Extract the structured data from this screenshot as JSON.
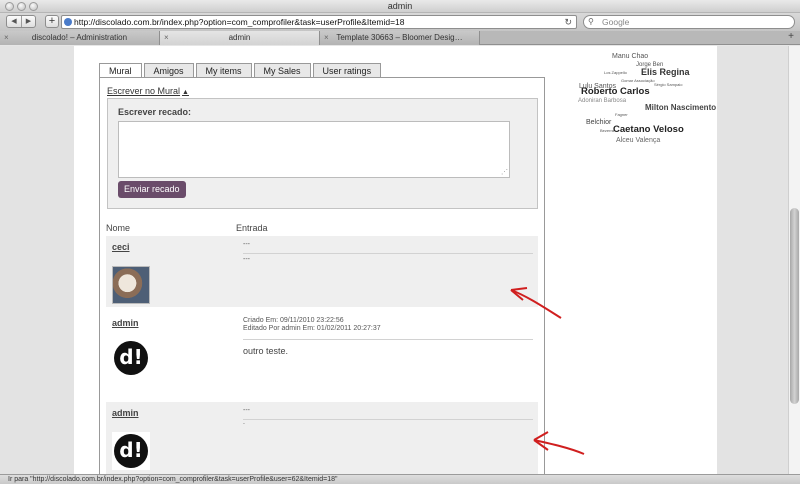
{
  "window": {
    "title": "admin"
  },
  "toolbar": {
    "back": "◀",
    "forward": "▶",
    "new_tab": "+",
    "url": "http://discolado.com.br/index.php?option=com_comprofiler&task=userProfile&Itemid=18",
    "reload": "↻",
    "search_placeholder": "Google"
  },
  "tabs": [
    {
      "label": "discolado! – Administration"
    },
    {
      "label": "admin"
    },
    {
      "label": "Template 30663 – Bloomer Desig…"
    }
  ],
  "profile_tabs": [
    "Mural",
    "Amigos",
    "My items",
    "My Sales",
    "User ratings"
  ],
  "mural": {
    "write_link": "Escrever no Mural",
    "write_label": "Escrever recado:",
    "send_button": "Enviar recado",
    "col_name": "Nome",
    "col_entry": "Entrada"
  },
  "entries": [
    {
      "user": "ceci",
      "line1": "---",
      "line2": "---",
      "body": ""
    },
    {
      "user": "admin",
      "line1": "Criado Em: 09/11/2010 23:22:56",
      "line2": "Editado Por admin Em: 01/02/2011 20:27:37",
      "body": "outro teste."
    },
    {
      "user": "admin",
      "line1": "---",
      "line2": "",
      "body": "."
    }
  ],
  "avatar_logo_text": "d!",
  "tag_cloud": [
    "Manu Chao",
    "Jorge Ben",
    "Los Zappello",
    "Elis Regina",
    "Gomar Associação",
    "Lulu Santos",
    "Sérgio Sampaio",
    "Roberto Carlos",
    "Adoniran Barbosa",
    "Milton Nascimento",
    "Fagner",
    "Belchior",
    "Bezerra",
    "Caetano Veloso",
    "Alceu Valença"
  ],
  "status_text": "Ir para \"http://discolado.com.br/index.php?option=com_comprofiler&task=userProfile&user=62&Itemid=18\"",
  "colors": {
    "button": "#6a4c6a",
    "arrow": "#d01f1f"
  }
}
